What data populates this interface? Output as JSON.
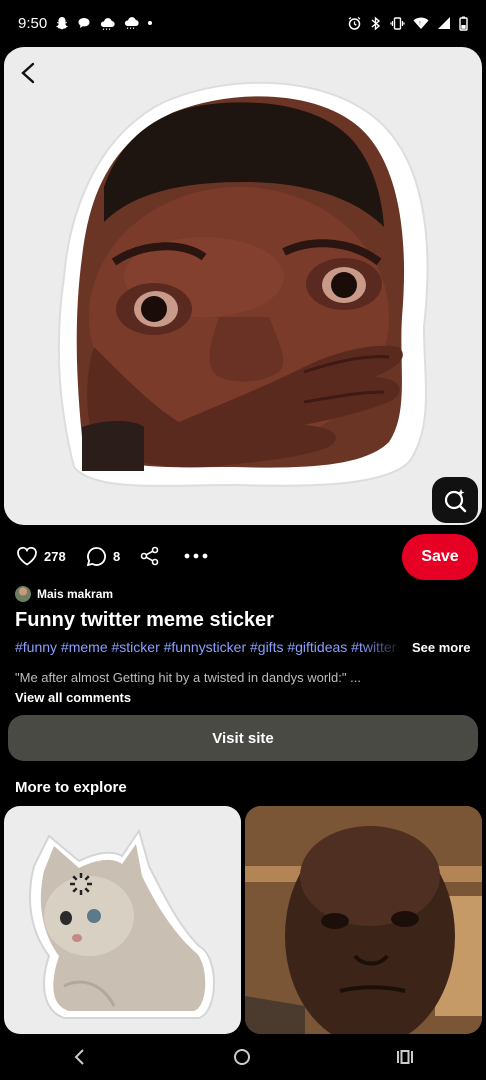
{
  "status_bar": {
    "time": "9:50"
  },
  "pin": {
    "image_alt": "sticker of crying man covering mouth"
  },
  "actions": {
    "like_count": "278",
    "comment_count": "8",
    "save_label": "Save"
  },
  "author": {
    "name": "Mais makram"
  },
  "title": "Funny twitter meme sticker",
  "tags": "#funny #meme #sticker #funnysticker #gifts #giftideas #twitter",
  "see_more": "See more",
  "comment_preview": "\"Me after almost Getting hit by a twisted in dandys world:\" ...",
  "view_comments": "View all comments",
  "visit_site": "Visit site",
  "more_to_explore": "More to explore",
  "colors": {
    "save": "#e60023",
    "tags": "#8aa0ff",
    "visit_bg": "#4a4a45"
  }
}
